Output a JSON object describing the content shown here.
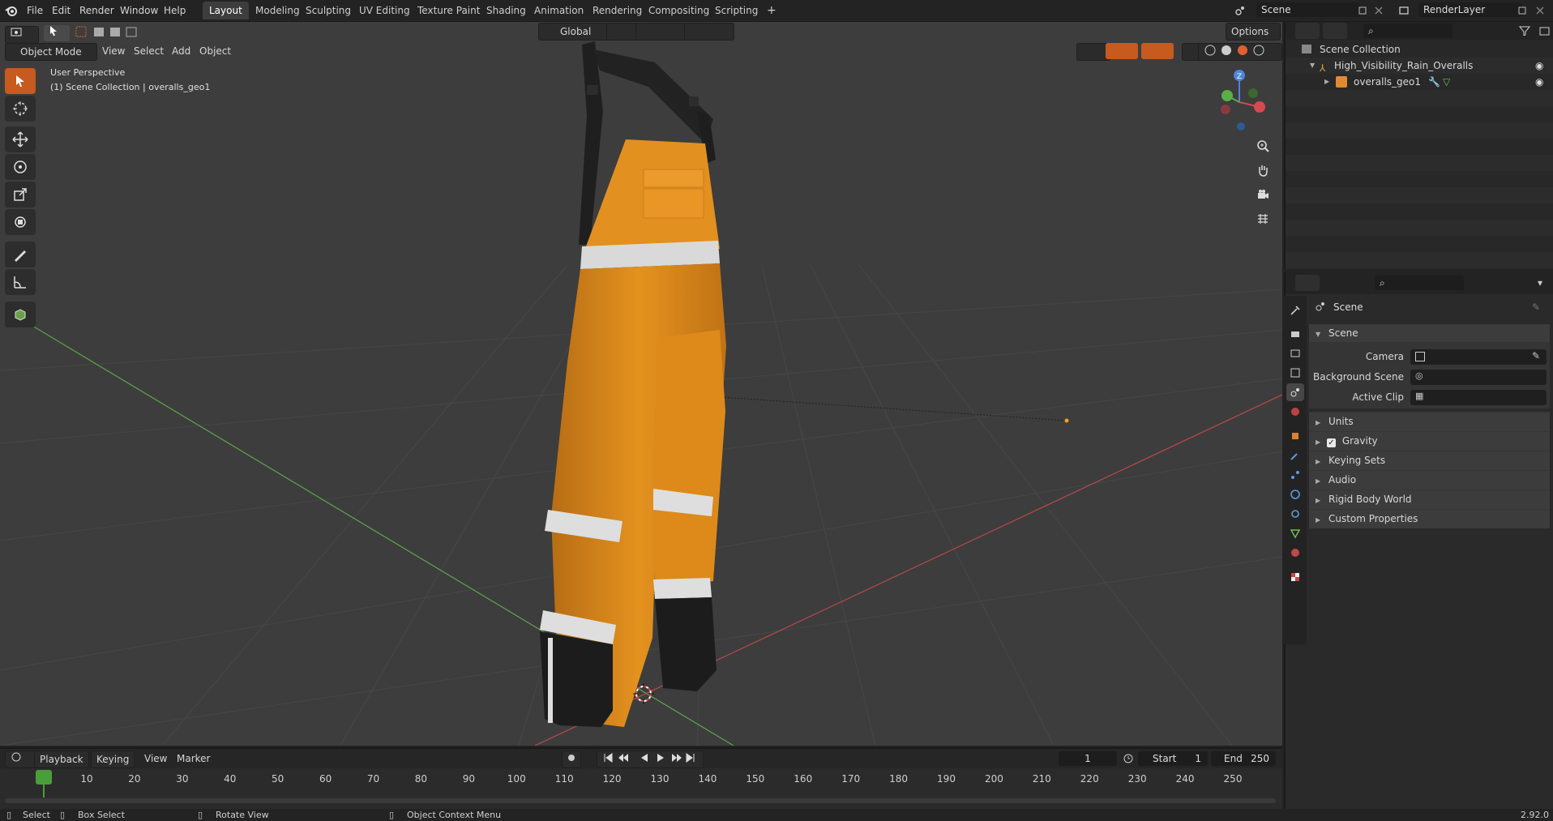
{
  "top_menu": [
    "File",
    "Edit",
    "Render",
    "Window",
    "Help"
  ],
  "workspace_tabs": [
    {
      "label": "Layout",
      "active": true
    },
    {
      "label": "Modeling"
    },
    {
      "label": "Sculpting"
    },
    {
      "label": "UV Editing"
    },
    {
      "label": "Texture Paint"
    },
    {
      "label": "Shading"
    },
    {
      "label": "Animation"
    },
    {
      "label": "Rendering"
    },
    {
      "label": "Compositing"
    },
    {
      "label": "Scripting"
    }
  ],
  "add_tab": "+",
  "scene_field": "Scene",
  "renderlayer_field": "RenderLayer",
  "viewport": {
    "mode_label": "Object Mode",
    "menus": [
      "View",
      "Select",
      "Add",
      "Object"
    ],
    "transform_orientation": "Global",
    "options_label": "Options",
    "overlay_title": "User Perspective",
    "overlay_subtitle": "(1) Scene Collection | overalls_geo1",
    "gizmo_axes": [
      "X",
      "Y",
      "Z"
    ]
  },
  "outliner": {
    "root": "Scene Collection",
    "collection": "High_Visibility_Rain_Overalls",
    "object": "overalls_geo1"
  },
  "properties": {
    "context": "Scene",
    "panel_title": "Scene",
    "fields": [
      {
        "label": "Camera",
        "value": ""
      },
      {
        "label": "Background Scene",
        "value": ""
      },
      {
        "label": "Active Clip",
        "value": ""
      }
    ],
    "subpanels": [
      {
        "label": "Units"
      },
      {
        "label": "Gravity",
        "checked": true
      },
      {
        "label": "Keying Sets"
      },
      {
        "label": "Audio"
      },
      {
        "label": "Rigid Body World"
      },
      {
        "label": "Custom Properties"
      }
    ]
  },
  "timeline": {
    "menus": [
      "Playback",
      "Keying",
      "View",
      "Marker"
    ],
    "current_frame": "1",
    "start_label": "Start",
    "start_value": "1",
    "end_label": "End",
    "end_value": "250",
    "ticks": [
      "1",
      "10",
      "20",
      "30",
      "40",
      "50",
      "60",
      "70",
      "80",
      "90",
      "100",
      "110",
      "120",
      "130",
      "140",
      "150",
      "160",
      "170",
      "180",
      "190",
      "200",
      "210",
      "220",
      "230",
      "240",
      "250"
    ]
  },
  "statusbar": {
    "select": "Select",
    "box_select": "Box Select",
    "rotate_view": "Rotate View",
    "context_menu": "Object Context Menu",
    "version": "2.92.0"
  },
  "colors": {
    "accent": "#c65a1f",
    "frame_marker": "#4a9e3a",
    "overalls_orange": "#e08a1e",
    "reflective": "#d8d8d8"
  }
}
